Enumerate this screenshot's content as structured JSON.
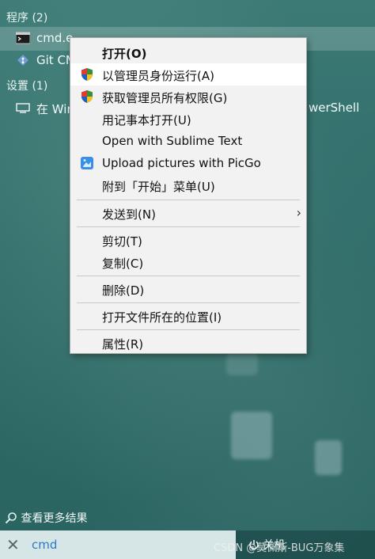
{
  "sections": {
    "programs": "程序 (2)",
    "settings": "设置 (1)"
  },
  "results": [
    {
      "label": "cmd.e",
      "selected": true
    },
    {
      "label": "Git CM"
    },
    {
      "label": "在 Win",
      "suffix": "werShell"
    }
  ],
  "context_menu": {
    "items": [
      {
        "label": "打开(O)",
        "bold": true
      },
      {
        "label": "以管理员身份运行(A)",
        "icon": "uac-shield-icon",
        "hover": true
      },
      {
        "label": "获取管理员所有权限(G)",
        "icon": "uac-shield-icon"
      },
      {
        "label": "用记事本打开(U)"
      },
      {
        "label": "Open with Sublime Text"
      },
      {
        "label": "Upload pictures with PicGo",
        "icon": "picgo-icon"
      },
      {
        "label": "附到「开始」菜单(U)"
      },
      {
        "label": "发送到(N)",
        "submenu": true
      },
      {
        "label": "剪切(T)"
      },
      {
        "label": "复制(C)"
      },
      {
        "label": "删除(D)"
      },
      {
        "label": "打开文件所在的位置(I)"
      },
      {
        "label": "属性(R)"
      }
    ],
    "submenu_arrow": "›"
  },
  "footer": {
    "more_results": "查看更多结果",
    "search_query": "cmd",
    "shutdown": "关机",
    "watermark": "CSDN @莫佩斯-BUG万象集"
  },
  "colors": {
    "accent_query": "#2c79c9",
    "menu_bg": "#f2f2f2"
  }
}
